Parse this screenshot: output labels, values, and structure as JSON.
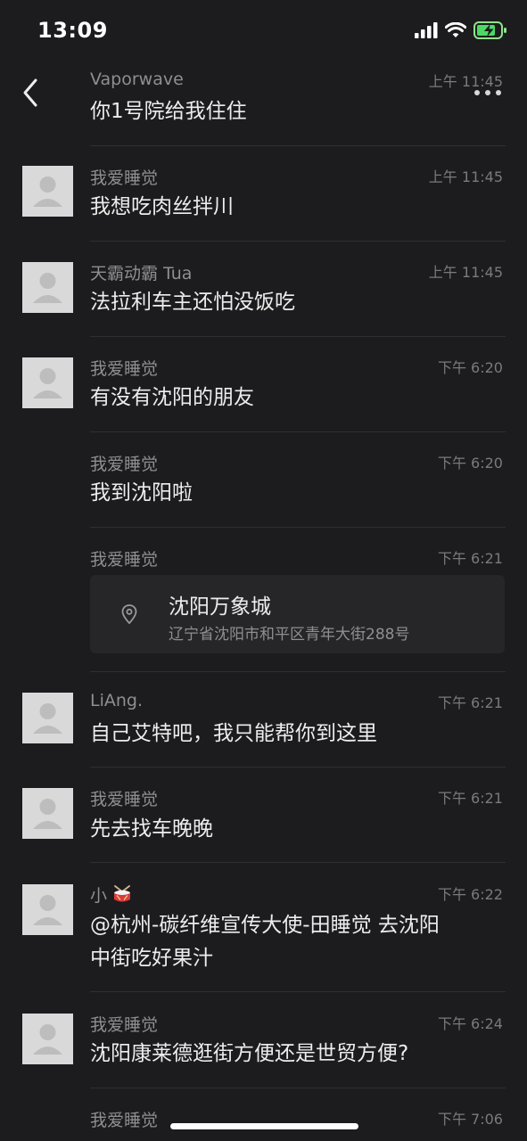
{
  "status_bar": {
    "time": "13:09"
  },
  "chat": {
    "messages": [
      {
        "sender": "Vaporwave",
        "time": "上午 11:45",
        "text": "你1号院给我住住"
      },
      {
        "sender": "我爱睡觉",
        "time": "上午 11:45",
        "text": "我想吃肉丝拌川"
      },
      {
        "sender": "天霸动霸 Tua",
        "time": "上午 11:45",
        "text": "法拉利车主还怕没饭吃"
      },
      {
        "sender": "我爱睡觉",
        "time": "下午 6:20",
        "text": "有没有沈阳的朋友"
      },
      {
        "sender": "我爱睡觉",
        "time": "下午 6:20",
        "text": "我到沈阳啦"
      },
      {
        "sender": "我爱睡觉",
        "time": "下午 6:21",
        "location": {
          "name": "沈阳万象城",
          "address": "辽宁省沈阳市和平区青年大街288号"
        }
      },
      {
        "sender": "LiAng.",
        "time": "下午 6:21",
        "text": "自己艾特吧，我只能帮你到这里"
      },
      {
        "sender": "我爱睡觉",
        "time": "下午 6:21",
        "text": "先去找车晚晚"
      },
      {
        "sender": "小",
        "time": "下午 6:22",
        "text_line1": "@杭州-碳纤维宣传大使-田睡觉 去沈阳",
        "text_line2": "中街吃好果汁"
      },
      {
        "sender": "我爱睡觉",
        "time": "下午 6:24",
        "text": "沈阳康莱德逛街方便还是世贸方便?"
      },
      {
        "sender": "我爱睡觉",
        "time": "下午 7:06",
        "text": ""
      }
    ]
  }
}
